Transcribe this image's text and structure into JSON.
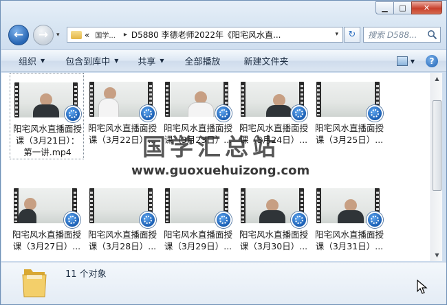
{
  "window": {
    "caption_buttons": {
      "minimize": "▁",
      "maximize": "□",
      "close": "✕"
    }
  },
  "nav": {
    "back_symbol": "←",
    "forward_symbol": "→",
    "dropdown_symbol": "▾"
  },
  "address_bar": {
    "prefix": "«",
    "segments": [
      "国学...",
      "D5880 李德老师2022年《阳宅风水直..."
    ],
    "separator": "▸",
    "dropdown_symbol": "▾"
  },
  "refresh_symbol": "↻",
  "search": {
    "placeholder": "搜索 D588..."
  },
  "toolbar": {
    "organize": "组织",
    "include_in_library": "包含到库中",
    "share": "共享",
    "play_all": "全部播放",
    "new_folder": "新建文件夹",
    "caret": "▼",
    "help": "?"
  },
  "files": [
    {
      "line1": "阳宅风水直播面授",
      "line2": "课（3月21日）：",
      "line3": "第一讲.mp4",
      "selected": true
    },
    {
      "line1": "阳宅风水直播面授",
      "line2": "课（3月22日）...",
      "line3": "",
      "selected": false
    },
    {
      "line1": "阳宅风水直播面授",
      "line2": "课（3月23日）...",
      "line3": "",
      "selected": false
    },
    {
      "line1": "阳宅风水直播面授",
      "line2": "课（3月24日）...",
      "line3": "",
      "selected": false
    },
    {
      "line1": "阳宅风水直播面授",
      "line2": "课（3月25日）...",
      "line3": "",
      "selected": false
    },
    {
      "line1": "阳宅风水直播面授",
      "line2": "课（3月27日）...",
      "line3": "",
      "selected": false
    },
    {
      "line1": "阳宅风水直播面授",
      "line2": "课（3月28日）...",
      "line3": "",
      "selected": false
    },
    {
      "line1": "阳宅风水直播面授",
      "line2": "课（3月29日）...",
      "line3": "",
      "selected": false
    },
    {
      "line1": "阳宅风水直播面授",
      "line2": "课（3月30日）...",
      "line3": "",
      "selected": false
    },
    {
      "line1": "阳宅风水直播面授",
      "line2": "课（3月31日）...",
      "line3": "",
      "selected": false
    }
  ],
  "watermark": {
    "title": "国学汇总站",
    "url": "www.guoxuehuizong.com"
  },
  "details": {
    "item_count": "11 个对象"
  },
  "colors": {
    "accent": "#2766b4",
    "close_button": "#c8402c",
    "folder": "#e3b545"
  }
}
